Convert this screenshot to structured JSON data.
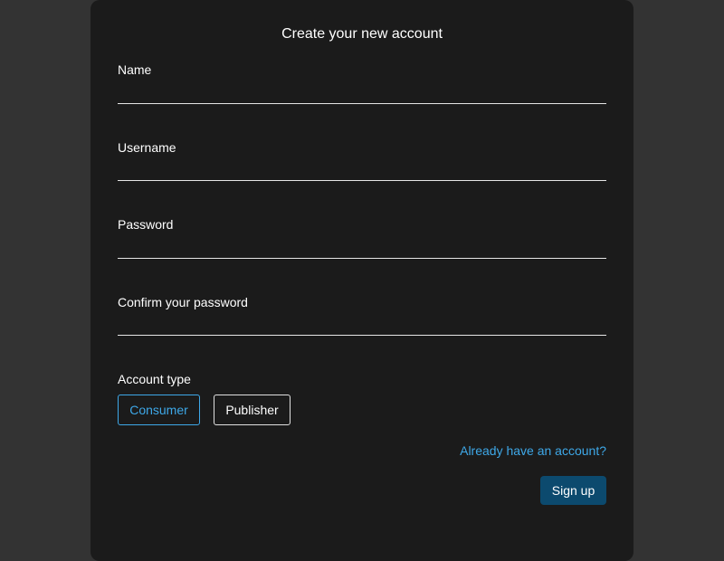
{
  "form": {
    "title": "Create your new account",
    "fields": [
      {
        "label": "Name",
        "value": ""
      },
      {
        "label": "Username",
        "value": ""
      },
      {
        "label": "Password",
        "value": ""
      },
      {
        "label": "Confirm your password",
        "value": ""
      }
    ],
    "account_type": {
      "label": "Account type",
      "options": [
        "Consumer",
        "Publisher"
      ],
      "selected": "Consumer"
    },
    "login_link": "Already have an account?",
    "submit_label": "Sign up"
  },
  "colors": {
    "page_bg": "#333333",
    "card_bg": "#1b1b1b",
    "accent": "#3ea8e8",
    "button_bg": "#0c4a6e"
  }
}
